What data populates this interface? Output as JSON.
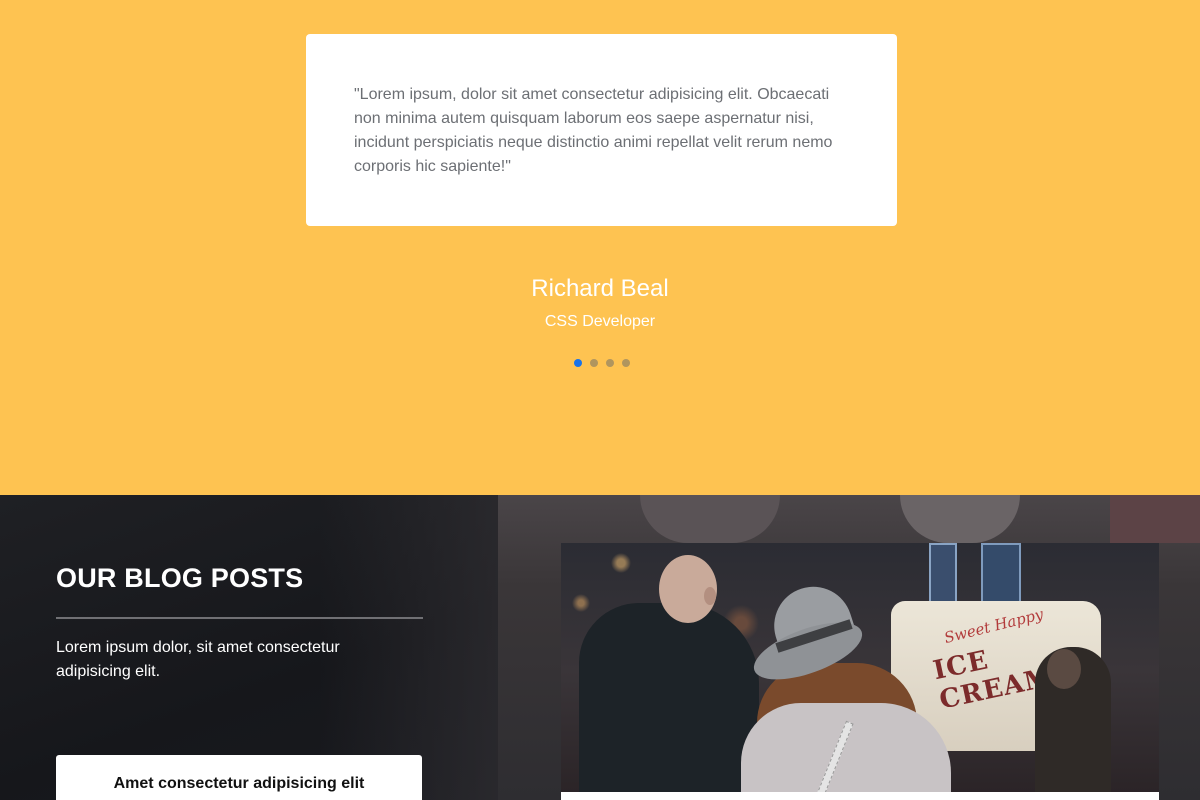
{
  "testimonial": {
    "quote": "\"Lorem ipsum, dolor sit amet consectetur adipisicing elit. Obcaecati non minima autem quisquam laborum eos saepe aspernatur nisi, incidunt perspiciatis neque distinctio animi repellat velit rerum nemo corporis hic sapiente!\"",
    "author_name": "Richard Beal",
    "author_role": "CSS Developer",
    "active_slide": 1,
    "slide_count": 4
  },
  "blog": {
    "title": "OUR BLOG POSTS",
    "description": "Lorem ipsum dolor, sit amet consectetur adipisicing elit.",
    "posts": [
      {
        "title": "Amet consectetur adipisicing elit"
      }
    ],
    "featured_image": {
      "alt": "",
      "truck_script": "Sweet Happy",
      "truck_text": "ICE CREAM"
    }
  },
  "colors": {
    "testimonial_bg": "#fec351",
    "active_dot": "#1a73e8",
    "inactive_dot": "#b0955e",
    "blog_bg": "#1b1c20"
  }
}
